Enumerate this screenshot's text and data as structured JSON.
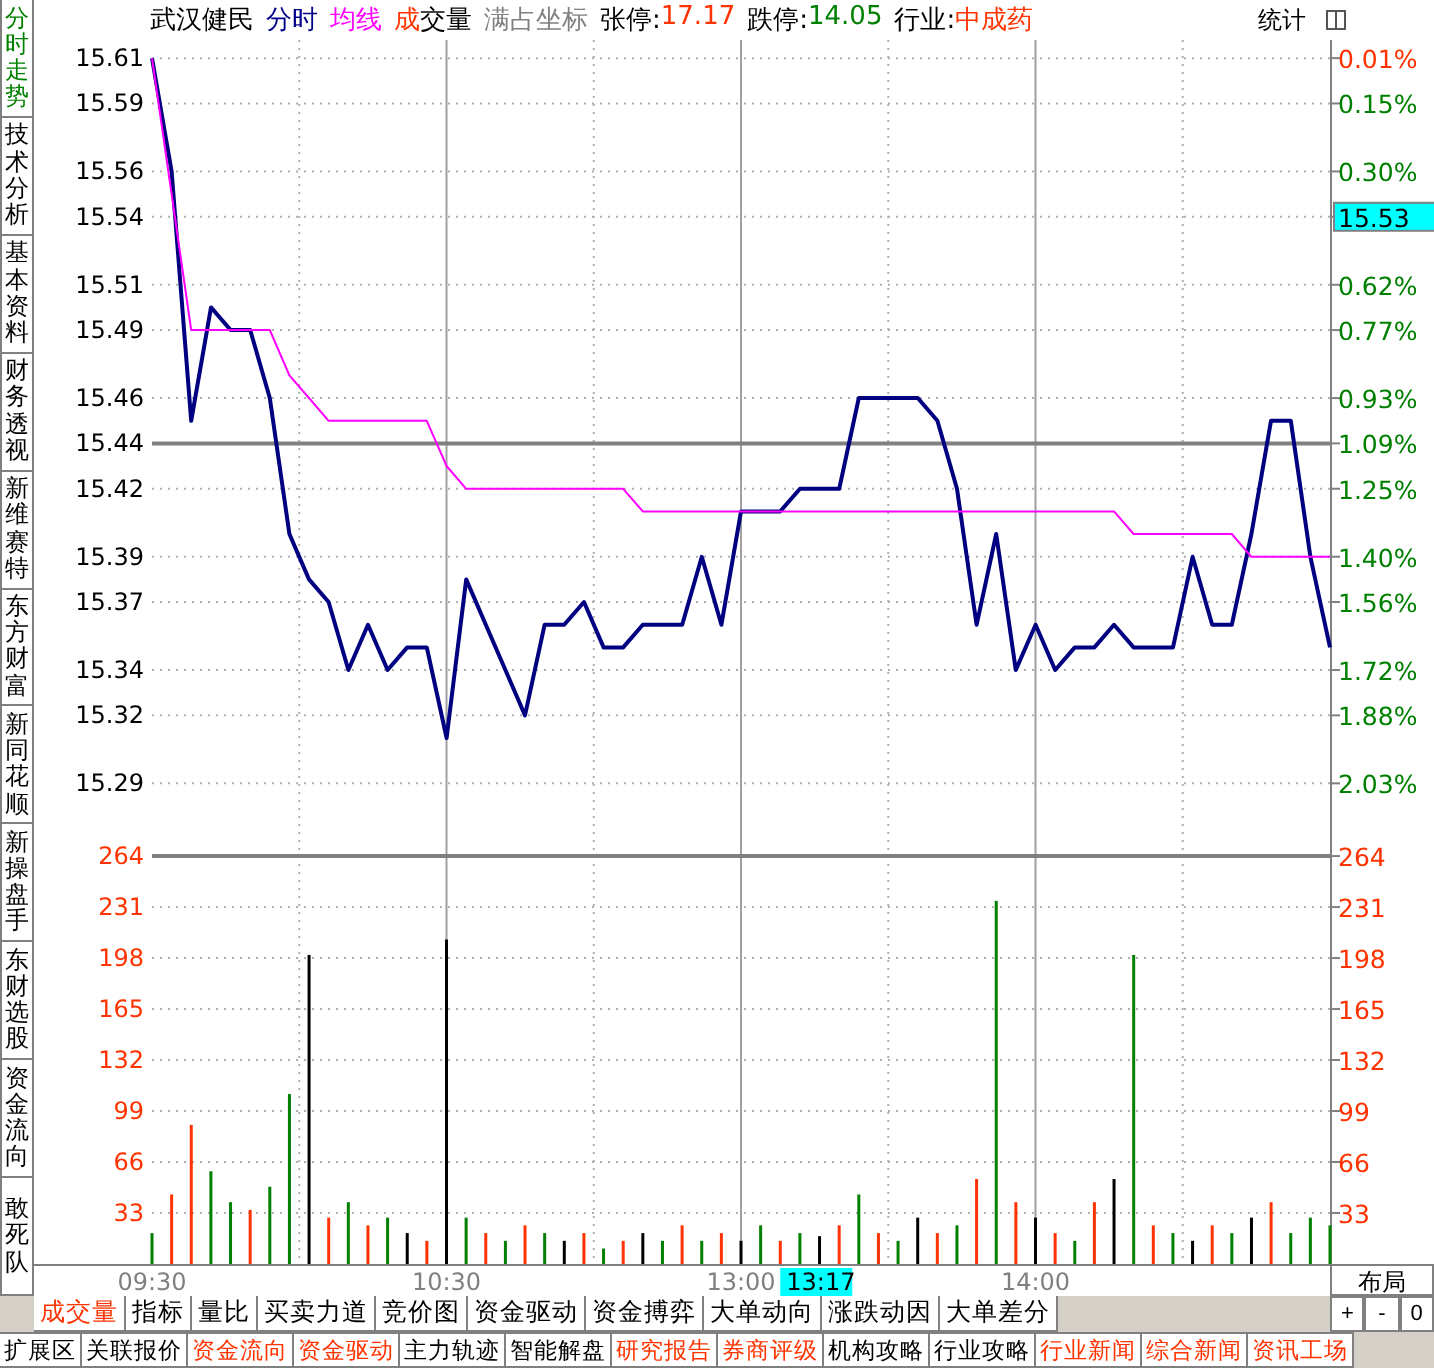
{
  "side_tabs": [
    {
      "label": "分时走势",
      "selected": true
    },
    {
      "label": "技术分析",
      "selected": false
    },
    {
      "label": "基本资料",
      "selected": false
    },
    {
      "label": "财务透视",
      "selected": false
    },
    {
      "label": "新维赛特",
      "selected": false
    },
    {
      "label": "东方财富",
      "selected": false
    },
    {
      "label": "新同花顺",
      "selected": false
    },
    {
      "label": "新操盘手",
      "selected": false
    },
    {
      "label": "东财选股",
      "selected": false
    },
    {
      "label": "资金流向",
      "selected": false
    },
    {
      "label": "敢死队",
      "selected": false
    }
  ],
  "header": {
    "stock_name": "武汉健民",
    "legend": [
      {
        "label": "分时",
        "kind": "time"
      },
      {
        "label": "均线",
        "kind": "avg"
      },
      {
        "label": "成交量",
        "kind": "volume"
      },
      {
        "label": "满占坐标",
        "kind": "option"
      }
    ],
    "limits": [
      {
        "label": "张停:",
        "value": "17.17",
        "kind": "up"
      },
      {
        "label": "跌停:",
        "value": "14.05",
        "kind": "down"
      },
      {
        "label": "行业:",
        "value": "中成药",
        "kind": "up"
      }
    ],
    "stats_button": "统计"
  },
  "price_panel": {
    "chart_data": {
      "type": "line",
      "categories": [
        null,
        null,
        null,
        null,
        null,
        null,
        null,
        null,
        null,
        null,
        null,
        null,
        null,
        null,
        null,
        null,
        null,
        null,
        null,
        null,
        null,
        null,
        null,
        null,
        null,
        null,
        null,
        null,
        null,
        null,
        null,
        null,
        null,
        null,
        null,
        null,
        null,
        null,
        null,
        null,
        null,
        null,
        null,
        null,
        null,
        null,
        null,
        null,
        null,
        null,
        null,
        null,
        null,
        null,
        null,
        null,
        null,
        null,
        null,
        null,
        null
      ],
      "series": [
        {
          "color": "#000080",
          "values": [
            15.61,
            15.56,
            15.45,
            15.5,
            15.49,
            15.49,
            15.46,
            15.4,
            15.38,
            15.37,
            15.34,
            15.36,
            15.34,
            15.35,
            15.35,
            15.31,
            15.38,
            15.36,
            15.34,
            15.32,
            15.36,
            15.36,
            15.37,
            15.35,
            15.35,
            15.36,
            15.36,
            15.36,
            15.39,
            15.36,
            15.41,
            15.41,
            15.41,
            15.42,
            15.42,
            15.42,
            15.46,
            15.46,
            15.46,
            15.46,
            15.45,
            15.42,
            15.36,
            15.4,
            15.34,
            15.36,
            15.34,
            15.35,
            15.35,
            15.36,
            15.35,
            15.35,
            15.35,
            15.39,
            15.36,
            15.36,
            15.4,
            15.45,
            15.45,
            15.39,
            15.35
          ]
        },
        {
          "color": "#ff00ff",
          "values": [
            15.61,
            15.55,
            15.49,
            15.49,
            15.49,
            15.49,
            15.49,
            15.47,
            15.46,
            15.45,
            15.45,
            15.45,
            15.45,
            15.45,
            15.45,
            15.43,
            15.42,
            15.42,
            15.42,
            15.42,
            15.42,
            15.42,
            15.42,
            15.42,
            15.42,
            15.41,
            15.41,
            15.41,
            15.41,
            15.41,
            15.41,
            15.41,
            15.41,
            15.41,
            15.41,
            15.41,
            15.41,
            15.41,
            15.41,
            15.41,
            15.41,
            15.41,
            15.41,
            15.41,
            15.41,
            15.41,
            15.41,
            15.41,
            15.41,
            15.41,
            15.4,
            15.4,
            15.4,
            15.4,
            15.4,
            15.4,
            15.39,
            15.39,
            15.39,
            15.39,
            15.39
          ]
        }
      ],
      "ylim": [
        15.265,
        15.618
      ],
      "grid": true,
      "ref_lines": [
        {
          "axis": "y",
          "value": 15.44
        }
      ],
      "yticks": [
        15.61,
        15.59,
        15.56,
        15.54,
        15.51,
        15.49,
        15.46,
        15.44,
        15.42,
        15.39,
        15.37,
        15.34,
        15.32,
        15.29
      ]
    },
    "right_labels": [
      {
        "label": "0.01%",
        "kind": "up"
      },
      {
        "label": "0.15%",
        "kind": "down"
      },
      {
        "label": "0.30%",
        "kind": "down"
      },
      {
        "label": "15.53",
        "kind": "current"
      },
      {
        "label": "0.62%",
        "kind": "down"
      },
      {
        "label": "0.77%",
        "kind": "down"
      },
      {
        "label": "0.93%",
        "kind": "down"
      },
      {
        "label": "1.09%",
        "kind": "down"
      },
      {
        "label": "1.25%",
        "kind": "down"
      },
      {
        "label": "1.40%",
        "kind": "down"
      },
      {
        "label": "1.56%",
        "kind": "down"
      },
      {
        "label": "1.72%",
        "kind": "down"
      },
      {
        "label": "1.88%",
        "kind": "down"
      },
      {
        "label": "2.03%",
        "kind": "down"
      }
    ]
  },
  "volume_panel": {
    "chart_data": {
      "type": "bar",
      "stacked": true,
      "categories": [
        "09:30",
        null,
        null,
        null,
        null,
        null,
        null,
        null,
        null,
        null,
        null,
        null,
        null,
        null,
        null,
        "10:30",
        null,
        null,
        null,
        null,
        null,
        null,
        null,
        null,
        null,
        null,
        null,
        null,
        null,
        null,
        "13:00",
        null,
        null,
        null,
        null,
        null,
        null,
        null,
        null,
        null,
        null,
        null,
        null,
        null,
        null,
        "14:00",
        null,
        null,
        null,
        null,
        null,
        null,
        null,
        null,
        null,
        null,
        null,
        null,
        null,
        null,
        null
      ],
      "series": [
        {
          "color": "#ff3300",
          "values": [
            null,
            45,
            90,
            null,
            null,
            35,
            null,
            null,
            null,
            30,
            null,
            25,
            null,
            null,
            15,
            null,
            null,
            20,
            null,
            25,
            null,
            null,
            20,
            null,
            15,
            null,
            null,
            25,
            null,
            20,
            null,
            null,
            15,
            null,
            null,
            25,
            null,
            20,
            null,
            null,
            20,
            null,
            55,
            null,
            40,
            null,
            20,
            null,
            40,
            null,
            null,
            25,
            null,
            null,
            25,
            null,
            null,
            40,
            null,
            null,
            null
          ]
        },
        {
          "color": "#008000",
          "values": [
            20,
            null,
            null,
            60,
            40,
            null,
            50,
            110,
            null,
            null,
            40,
            null,
            30,
            null,
            null,
            null,
            30,
            null,
            15,
            null,
            20,
            null,
            null,
            10,
            null,
            null,
            15,
            null,
            15,
            null,
            null,
            25,
            null,
            20,
            null,
            null,
            45,
            null,
            15,
            null,
            null,
            25,
            null,
            235,
            null,
            null,
            null,
            15,
            null,
            null,
            200,
            null,
            20,
            null,
            null,
            20,
            null,
            null,
            20,
            30,
            25
          ]
        },
        {
          "color": "#000000",
          "values": [
            null,
            null,
            null,
            null,
            null,
            null,
            null,
            null,
            200,
            null,
            null,
            null,
            null,
            20,
            null,
            210,
            null,
            null,
            null,
            null,
            null,
            15,
            null,
            null,
            null,
            20,
            null,
            null,
            null,
            null,
            15,
            null,
            null,
            null,
            18,
            null,
            null,
            null,
            null,
            30,
            null,
            null,
            null,
            null,
            null,
            30,
            null,
            null,
            null,
            55,
            null,
            null,
            null,
            15,
            null,
            null,
            30,
            null,
            null,
            null,
            null
          ]
        }
      ],
      "ylim": [
        0,
        274.4
      ],
      "grid": true,
      "ref_lines": [
        {
          "axis": "y",
          "value": 264
        }
      ],
      "yticks": [
        33,
        66,
        99,
        132,
        165,
        198,
        231,
        264
      ]
    },
    "right_labels": [
      "264",
      "231",
      "198",
      "165",
      "132",
      "99",
      "66",
      "33"
    ],
    "cursor_time": "13:17",
    "layout_button": "布局"
  },
  "sub_tabs": [
    {
      "label": "成交量",
      "selected": true
    },
    {
      "label": "指标",
      "selected": false
    },
    {
      "label": "量比",
      "selected": false
    },
    {
      "label": "买卖力道",
      "selected": false
    },
    {
      "label": "竞价图",
      "selected": false
    },
    {
      "label": "资金驱动",
      "selected": false
    },
    {
      "label": "资金搏弈",
      "selected": false
    },
    {
      "label": "大单动向",
      "selected": false
    },
    {
      "label": "涨跌动因",
      "selected": false
    },
    {
      "label": "大单差分",
      "selected": false
    }
  ],
  "zoom_buttons": [
    "+",
    "-",
    "0"
  ],
  "bottom_tabs": [
    {
      "label": "扩展区",
      "highlighted": false
    },
    {
      "label": "关联报价",
      "highlighted": false
    },
    {
      "label": "资金流向",
      "highlighted": true
    },
    {
      "label": "资金驱动",
      "highlighted": true
    },
    {
      "label": "主力轨迹",
      "highlighted": false
    },
    {
      "label": "智能解盘",
      "highlighted": false
    },
    {
      "label": "研究报告",
      "highlighted": true
    },
    {
      "label": "券商评级",
      "highlighted": true
    },
    {
      "label": "机构攻略",
      "highlighted": false
    },
    {
      "label": "行业攻略",
      "highlighted": false
    },
    {
      "label": "行业新闻",
      "highlighted": true
    },
    {
      "label": "综合新闻",
      "highlighted": true
    },
    {
      "label": "资讯工场",
      "highlighted": true
    }
  ]
}
